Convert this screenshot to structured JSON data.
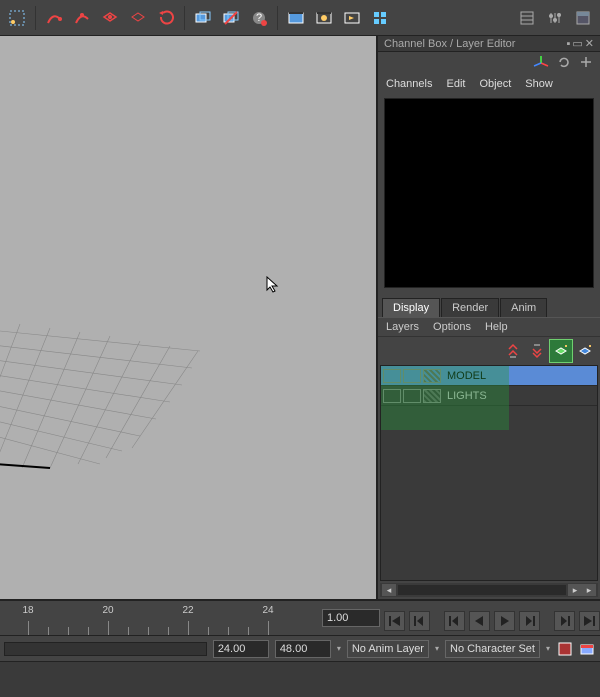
{
  "toolbar": {
    "icons": [
      "select-lasso",
      "snap-curve-red",
      "snap-point-red",
      "snap-surface-red",
      "snap-grid-red",
      "snap-toggle-red",
      "divider",
      "history-on",
      "history-off",
      "construction-history",
      "divider",
      "render-frame",
      "render-anim",
      "render-batch",
      "ipr",
      "render-settings"
    ],
    "right_icons": [
      "attr-editor",
      "tool-settings",
      "channel-box"
    ]
  },
  "panel": {
    "title": "Channel Box / Layer Editor",
    "menu": {
      "channels": "Channels",
      "edit": "Edit",
      "object": "Object",
      "show": "Show"
    },
    "layer_tabs": {
      "display": "Display",
      "render": "Render",
      "anim": "Anim"
    },
    "layer_menu": {
      "layers": "Layers",
      "options": "Options",
      "help": "Help"
    },
    "layers": [
      {
        "name": "MODEL",
        "selected": true
      },
      {
        "name": "LIGHTS",
        "selected": false
      }
    ]
  },
  "timeline": {
    "ticks": [
      18,
      20,
      22,
      24
    ],
    "current_frame": "1.00"
  },
  "bottom": {
    "start": "24.00",
    "end": "48.00",
    "anim_layer": "No Anim Layer",
    "char_set": "No Character Set"
  }
}
